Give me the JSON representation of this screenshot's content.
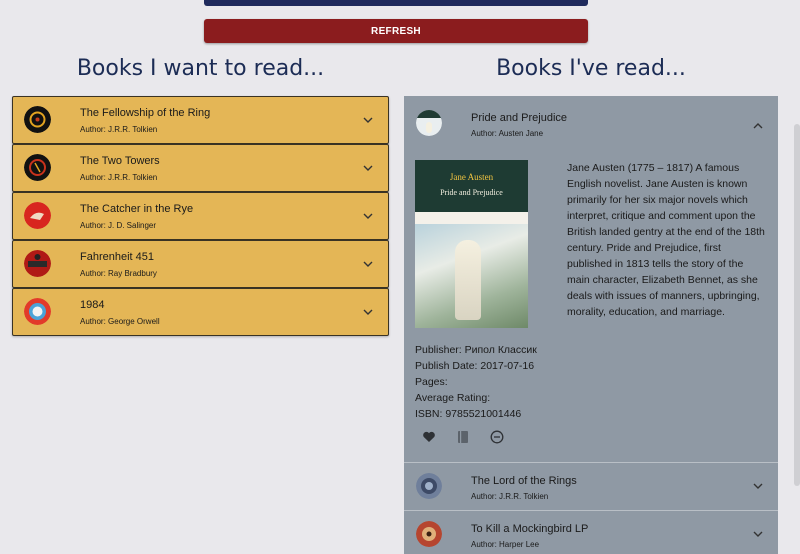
{
  "toolbar": {
    "refresh_label": "REFRESH"
  },
  "want": {
    "heading": "Books I want to read...",
    "books": [
      {
        "title": "The Fellowship of the Ring",
        "author": "Author: J.R.R. Tolkien"
      },
      {
        "title": "The Two Towers",
        "author": "Author: J.R.R. Tolkien"
      },
      {
        "title": "The Catcher in the Rye",
        "author": "Author: J. D. Salinger"
      },
      {
        "title": "Fahrenheit 451",
        "author": "Author: Ray Bradbury"
      },
      {
        "title": "1984",
        "author": "Author: George Orwell"
      }
    ]
  },
  "read": {
    "heading": "Books I've read...",
    "expanded": {
      "title": "Pride and Prejudice",
      "author": "Author: Austen Jane",
      "cover_author": "Jane Austen",
      "cover_title": "Pride and Prejudice",
      "description": "Jane Austen (1775 – 1817) A famous English novelist. Jane Austen is known primarily for her six major novels which interpret, critique and comment upon the British landed gentry at the end of the 18th century. Pride and Prejudice, first published in 1813 tells the story of the main character, Elizabeth Bennet, as she deals with issues of manners, upbringing, morality, education, and marriage.",
      "publisher": "Publisher: Рипол Классик",
      "publish_date": "Publish Date: 2017-07-16",
      "pages": "Pages:",
      "rating": "Average Rating:",
      "isbn": "ISBN: 9785521001446"
    },
    "books": [
      {
        "title": "The Lord of the Rings",
        "author": "Author: J.R.R. Tolkien"
      },
      {
        "title": "To Kill a Mockingbird LP",
        "author": "Author: Harper Lee"
      }
    ]
  },
  "colors": {
    "accent_blue": "#1f2a5c",
    "refresh_red": "#8b1c1e",
    "want_card": "#e4b656",
    "read_card": "#8f99a4"
  }
}
